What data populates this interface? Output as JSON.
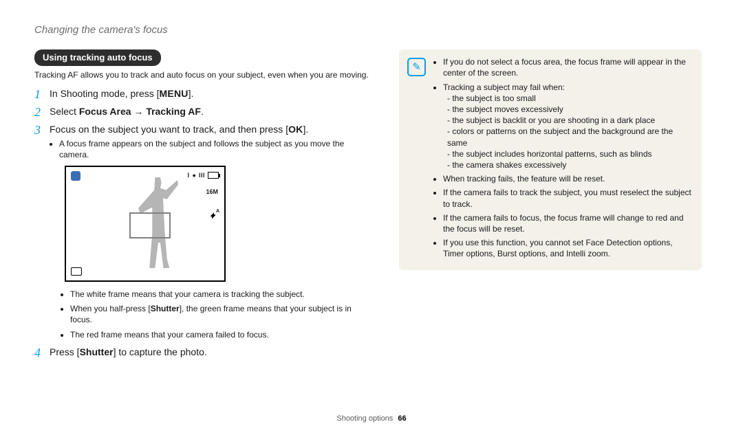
{
  "header": {
    "section_title": "Changing the camera's focus"
  },
  "pill": {
    "label": "Using tracking auto focus"
  },
  "intro": "Tracking AF allows you to track and auto focus on your subject, even when you are moving.",
  "steps": {
    "s1": {
      "num": "1",
      "pre": "In Shooting mode, press [",
      "key": "MENU",
      "post": "]."
    },
    "s2": {
      "num": "2",
      "pre": "Select ",
      "b1": "Focus Area",
      "arrow": " → ",
      "b2": "Tracking AF",
      "post": "."
    },
    "s3": {
      "num": "3",
      "pre": "Focus on the subject you want to track, and then press [",
      "key": "OK",
      "post": "].",
      "sub1": "A focus frame appears on the subject and follows the subject as you move the camera."
    },
    "s4": {
      "num": "4",
      "pre": "Press [",
      "b": "Shutter",
      "post": "] to capture the photo."
    }
  },
  "lcd": {
    "mp": "16M",
    "flash": "ꜰᴬ",
    "count_i": "I",
    "count_dot": "●",
    "bars": "III"
  },
  "frameNotes": {
    "n1": "The white frame means that your camera is tracking the subject.",
    "n2_pre": "When you half-press [",
    "n2_b": "Shutter",
    "n2_post": "], the green frame means that your subject is in focus.",
    "n3": "The red frame means that your camera failed to focus."
  },
  "note": {
    "b1": "If you do not select a focus area, the focus frame will appear in the center of the screen.",
    "b2": "Tracking a subject may fail when:",
    "b2s": {
      "a": "the subject is too small",
      "b": "the subject moves excessively",
      "c": "the subject is backlit or you are shooting in a dark place",
      "d": "colors or patterns on the subject and the background are the same",
      "e": "the subject includes horizontal patterns, such as blinds",
      "f": "the camera shakes excessively"
    },
    "b3": "When tracking fails, the feature will be reset.",
    "b4": "If the camera fails to track the subject, you must reselect the subject to track.",
    "b5": "If the camera fails to focus, the focus frame will change to red and the focus will be reset.",
    "b6": "If you use this function, you cannot set Face Detection options, Timer options, Burst options, and Intelli zoom."
  },
  "footer": {
    "label": "Shooting options",
    "page": "66"
  }
}
